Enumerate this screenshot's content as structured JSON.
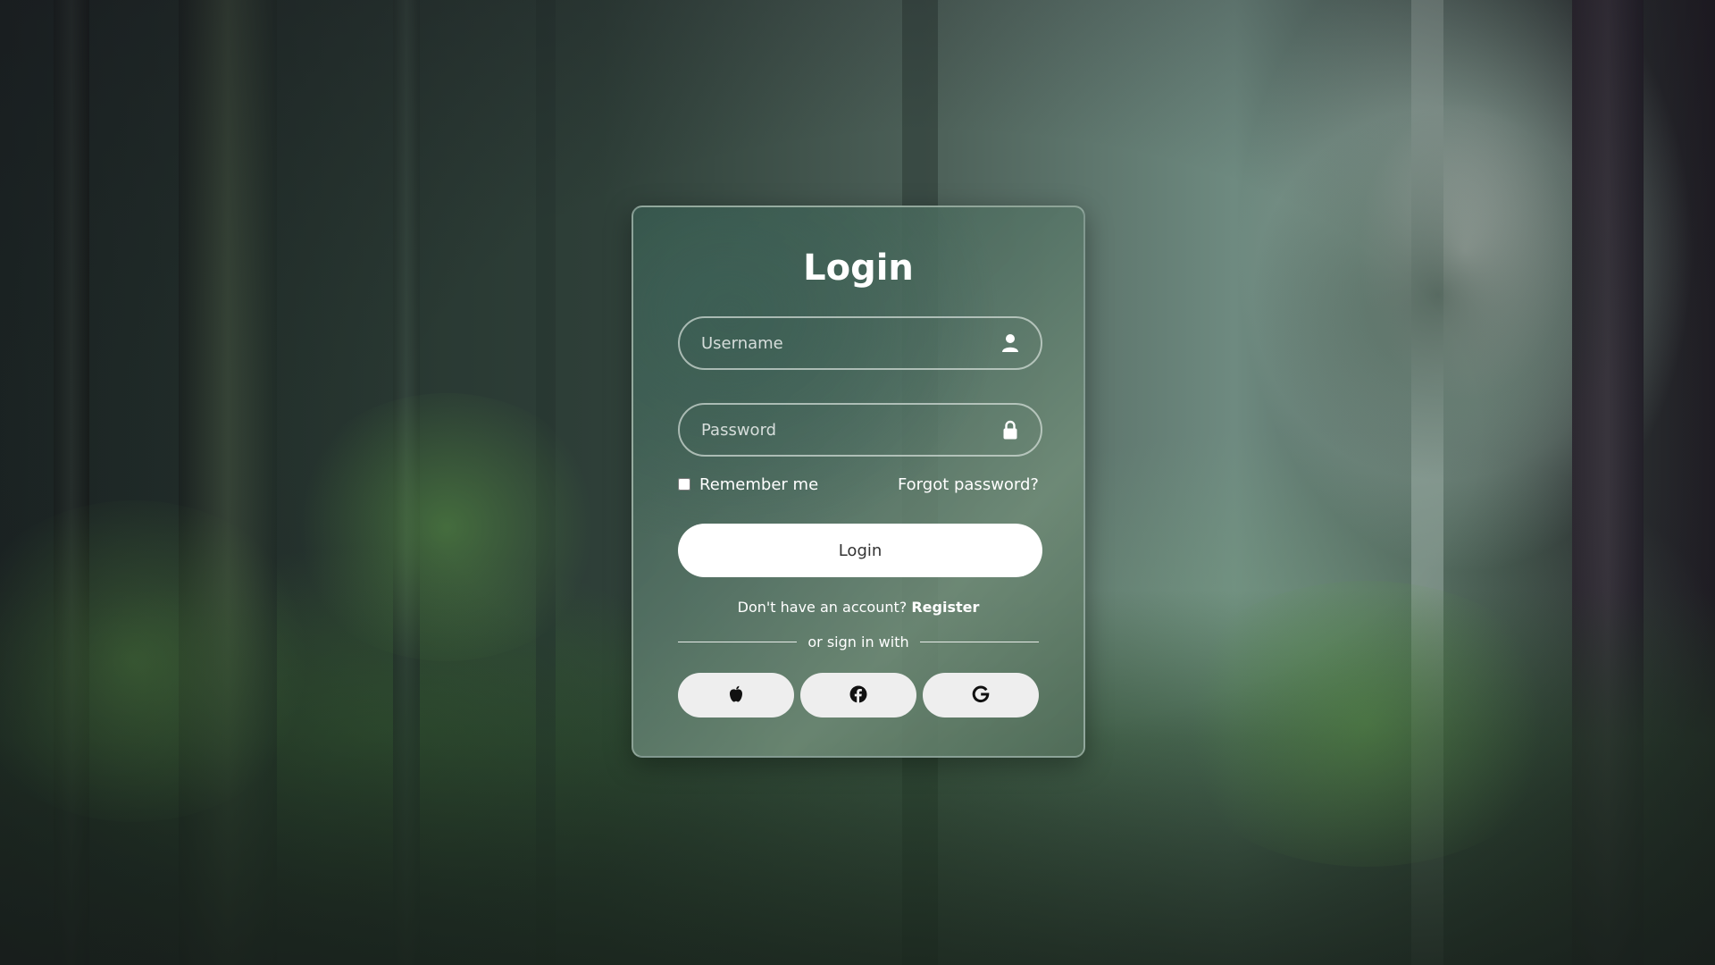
{
  "login_card": {
    "title": "Login",
    "username": {
      "placeholder": "Username",
      "value": "",
      "icon": "user-icon"
    },
    "password": {
      "placeholder": "Password",
      "value": "",
      "icon": "lock-icon"
    },
    "remember_me": {
      "label": "Remember me",
      "checked": false
    },
    "forgot_password": "Forgot password?",
    "login_button": "Login",
    "register": {
      "prompt": "Don't have an account?",
      "link": "Register"
    },
    "divider": "or sign in with",
    "social_buttons": [
      {
        "icon": "apple-icon"
      },
      {
        "icon": "facebook-icon"
      },
      {
        "icon": "google-icon"
      }
    ]
  },
  "colors": {
    "card_border": "#c2d0c8",
    "button_bg": "#ffffff",
    "button_text": "#333333",
    "social_bg": "#eeeeee",
    "text": "#ffffff"
  }
}
